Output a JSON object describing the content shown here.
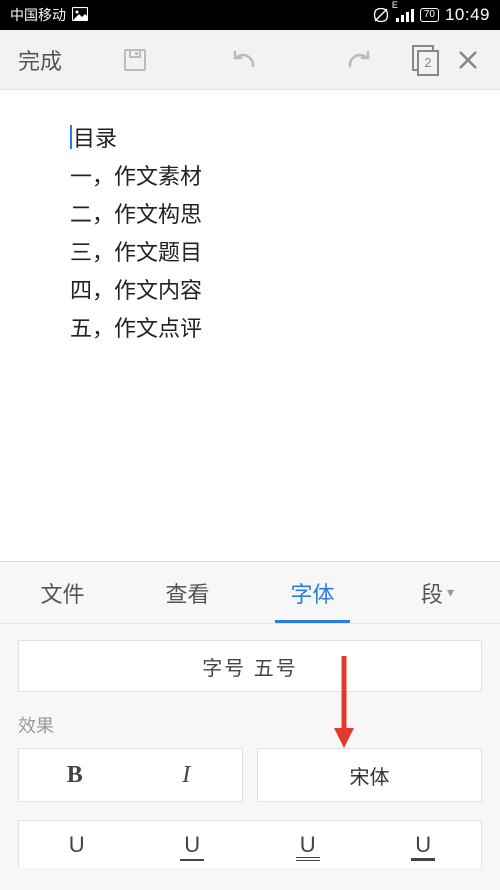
{
  "status": {
    "carrier": "中国移动",
    "network_indicator": "E",
    "battery_text": "70",
    "time": "10:49"
  },
  "toolbar": {
    "done_label": "完成",
    "page_count": "2"
  },
  "document": {
    "lines": [
      "目录",
      "一，作文素材",
      "二，作文构思",
      "三，作文题目",
      "四，作文内容",
      "五，作文点评"
    ]
  },
  "panel": {
    "tabs": {
      "file": "文件",
      "view": "查看",
      "font": "字体",
      "paragraph": "段"
    },
    "active_tab": "font",
    "font_size_label": "字号 五号",
    "effects_label": "效果",
    "bold_glyph": "B",
    "italic_glyph": "I",
    "font_family": "宋体",
    "underline_glyph": "U"
  },
  "annotation": {
    "arrow_color": "#e23b2e"
  }
}
